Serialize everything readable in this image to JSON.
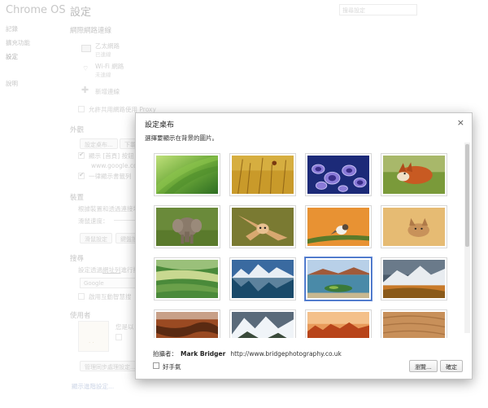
{
  "sidebar": {
    "title": "Chrome OS",
    "items": [
      {
        "label": "記錄"
      },
      {
        "label": "擴充功能"
      },
      {
        "label": "設定"
      },
      {
        "label": "說明"
      }
    ]
  },
  "page": {
    "title": "設定",
    "search_placeholder": "搜尋設定"
  },
  "network": {
    "heading": "網際網路連線",
    "ethernet": {
      "name": "乙太網路",
      "status": "已連線"
    },
    "wifi": {
      "name": "Wi-Fi 網路",
      "status": "未連線"
    },
    "add_connection": "新增連線",
    "proxy_checkbox": "允許共用網路使用 Proxy"
  },
  "appearance": {
    "heading": "外觀",
    "set_wallpaper_button": "設定桌布...",
    "theme_button": "下載",
    "show_home_checkbox": "顯示 [首頁] 按鈕",
    "home_url": "www.google.com",
    "bookmark_bar_checkbox": "一律顯示書籤列"
  },
  "device": {
    "heading": "裝置",
    "description": "根據裝置和透過連接埠",
    "touchpad_speed": "滑鼠速度：",
    "touchpad_button": "滑鼠設定",
    "keyboard_button": "鍵盤設"
  },
  "search": {
    "heading": "搜尋",
    "description_prefix": "設定透過",
    "description_link": "網址列",
    "description_suffix": "進行搜",
    "engine_value": "Google",
    "instant_checkbox": "啟用互動智慧搜"
  },
  "users": {
    "heading": "使用者",
    "description": "您是以",
    "sync_button": "管理同步處理設定..."
  },
  "advanced_link": "顯示進階設定...",
  "dialog": {
    "title": "設定桌布",
    "close_glyph": "×",
    "instruction": "選擇要顯示在背景的圖片。",
    "credit_label": "拍攝者：",
    "photographer": "Mark Bridger",
    "photographer_url": "http://www.bridgephotography.co.uk",
    "surprise_checkbox": "好手氣",
    "browse_button": "瀏覽...",
    "ok_button": "確定",
    "selected_index": 10,
    "wallpapers": [
      {
        "name": "green-grass-blades"
      },
      {
        "name": "golden-grass-with-insect"
      },
      {
        "name": "purple-cup-fungi"
      },
      {
        "name": "fox-resting-on-grass"
      },
      {
        "name": "elephant-calf"
      },
      {
        "name": "owl-in-flight"
      },
      {
        "name": "bird-on-mossy-branch"
      },
      {
        "name": "fox-cub-in-sand"
      },
      {
        "name": "green-rolling-fields"
      },
      {
        "name": "mountain-lake-reflection"
      },
      {
        "name": "beach-with-mossy-rocks"
      },
      {
        "name": "stormy-mountains-autumn"
      },
      {
        "name": "red-canyon"
      },
      {
        "name": "snowy-mountain-valley"
      },
      {
        "name": "sunset-autumn-trees"
      },
      {
        "name": "sand-dune-ripples"
      }
    ]
  },
  "icons": {
    "ethernet": "ethernet-icon",
    "wifi": "wifi-icon",
    "add": "plus-icon",
    "close": "close-icon"
  }
}
